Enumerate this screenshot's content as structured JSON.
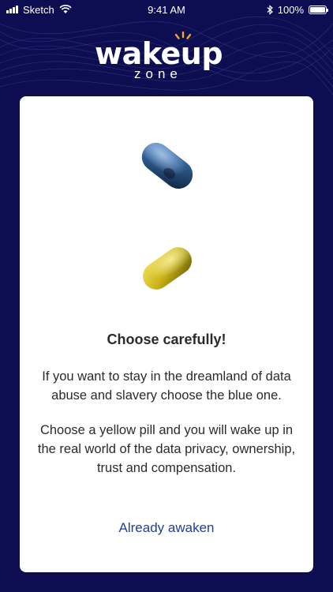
{
  "status_bar": {
    "carrier": "Sketch",
    "time": "9:41 AM",
    "battery": "100%",
    "icons": [
      "signal-icon",
      "wifi-icon",
      "bluetooth-icon",
      "battery-icon"
    ]
  },
  "logo": {
    "word": "wakeup",
    "sub": "zone",
    "accent_color": "#f5a623"
  },
  "card": {
    "title": "Choose carefully!",
    "paragraph1": "If you want to stay in the dreamland of data abuse and slavery choose the blue one.",
    "paragraph2": "Choose a yellow pill and you will wake up in the real world of the data privacy, ownership, trust and compensation.",
    "link": "Already awaken"
  },
  "colors": {
    "background": "#0d0e52",
    "card": "#ffffff",
    "link": "#1e3fa0",
    "pill_blue": "#2d5a8c",
    "pill_yellow": "#c9b318"
  }
}
